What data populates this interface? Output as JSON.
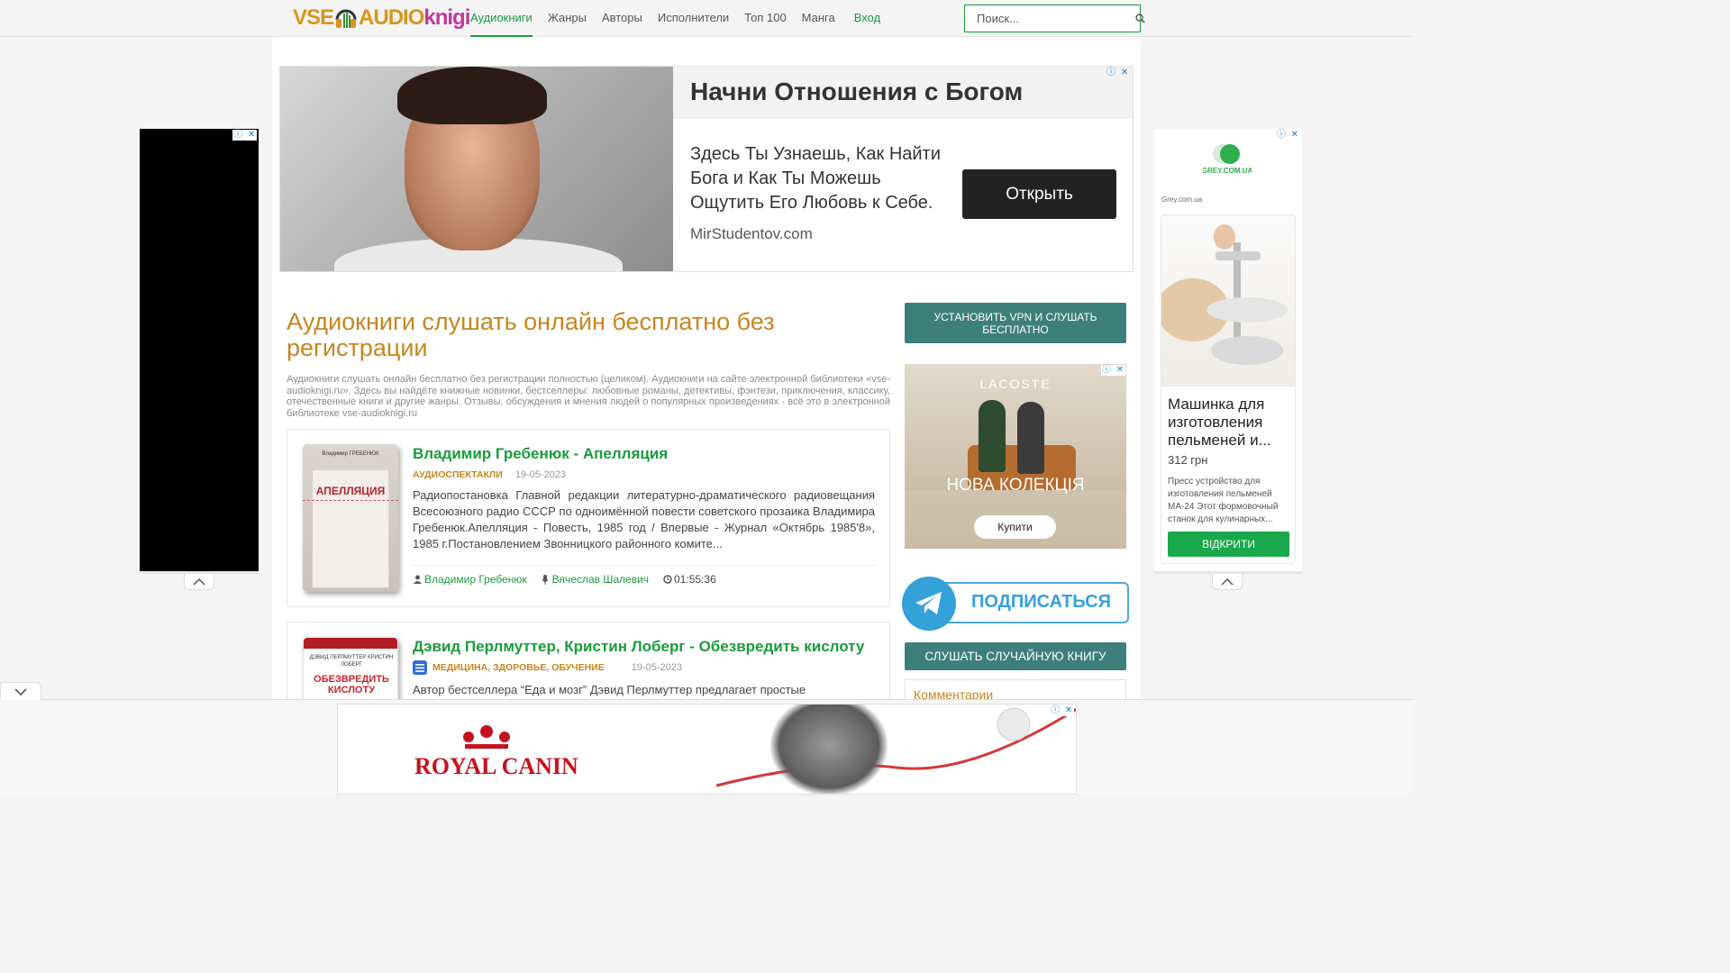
{
  "header": {
    "logo": {
      "part1": "VSE",
      "part2": "AUDIO",
      "part3": "knigi"
    },
    "nav": [
      {
        "label": "Аудиокниги",
        "active": true
      },
      {
        "label": "Жанры"
      },
      {
        "label": "Авторы"
      },
      {
        "label": "Исполнители"
      },
      {
        "label": "Топ 100"
      },
      {
        "label": "Манга"
      }
    ],
    "login": "Вход",
    "search_placeholder": "Поиск..."
  },
  "top_ad": {
    "headline": "Начни Отношения с Богом",
    "body": "Здесь Ты Узнаешь, Как Найти Бога и Как Ты Можешь Ощутить Его Любовь к Себе.",
    "domain": "MirStudentov.com",
    "button": "Открыть"
  },
  "page": {
    "title": "Аудиокниги слушать онлайн бесплатно без регистрации",
    "intro": "Аудиокниги слушать онлайн бесплатно без регистрации полностью (целиком). Аудиокниги на сайте электронной библиотеки «vse-audioknigi.ru». Здесь вы найдёте книжные новинки, бестселлеры: любовные романы, детективы, фэнтези, приключения, классику, отечественные книги и другие жанры. Отзывы, обсуждения и мнения людей о популярных произведениях - всё это в электронной библиотеке vse-audioknigi.ru"
  },
  "books": [
    {
      "title": "Владимир Гребенюк - Апелляция",
      "category": "АУДИОСПЕКТАКЛИ",
      "date": "19-05-2023",
      "description": "Радиопостановка Главной редакции литературно-драматического радиовещания Всесоюзного радио СССР по одноимённой повести советского прозаика Владимира Гребенюк.Апелляция - Повесть, 1985 год / Впервые - Журнал «Октябрь 1985'8», 1985 г.Постановлением Звонницкого районного комите...",
      "author": "Владимир Гребенюк",
      "reader": "Вячеслав Шалевич",
      "duration": "01:55:36",
      "cover_author": "Владимир ГРЕБЕНЮК",
      "cover_title": "АПЕЛЛЯЦИЯ"
    },
    {
      "title": "Дэвид Перлмуттер, Кристин Лоберг - Обезвредить кислоту",
      "category": "МЕДИЦИНА, ЗДОРОВЬЕ, ОБУЧЕНИЕ",
      "date": "19-05-2023",
      "description": "Автор бестселлера “Еда и мозг” Дэвид Перлмуттер предлагает простые",
      "cover_author": "ДЭВИД ПЕРЛМУТТЕР\nКРИСТИН ЛОБЕРГ",
      "cover_title": "ОБЕЗВРЕДИТЬ КИСЛОТУ"
    }
  ],
  "sidebar": {
    "vpn_button": "УСТАНОВИТЬ VPN И СЛУШАТЬ БЕСПЛАТНО",
    "lacoste_ad": {
      "brand": "LACOSTE",
      "headline": "НОВА КОЛЕКЦІЯ",
      "button": "Купити"
    },
    "telegram": "ПОДПИСАТЬСЯ",
    "random_button": "СЛУШАТЬ СЛУЧАЙНУЮ КНИГУ",
    "comments_title": "Комментарии"
  },
  "right_ad": {
    "logo_text": "GREY.COM.UA",
    "source": "Grey.com.ua",
    "product_title": "Машинка для изготовления пельменей и...",
    "price": "312 грн",
    "description": "Пресс устройство для изготовления пельменей МА-24 Этот формовочный станок для кулинарных...",
    "button": "ВІДКРИТИ"
  },
  "bottom_ad": {
    "brand": "ROYAL CANIN"
  },
  "colors": {
    "accent_green": "#1a9b3c",
    "title_orange": "#c8851d",
    "teal_button": "#3d7f7a",
    "telegram_blue": "#34a1d8"
  }
}
